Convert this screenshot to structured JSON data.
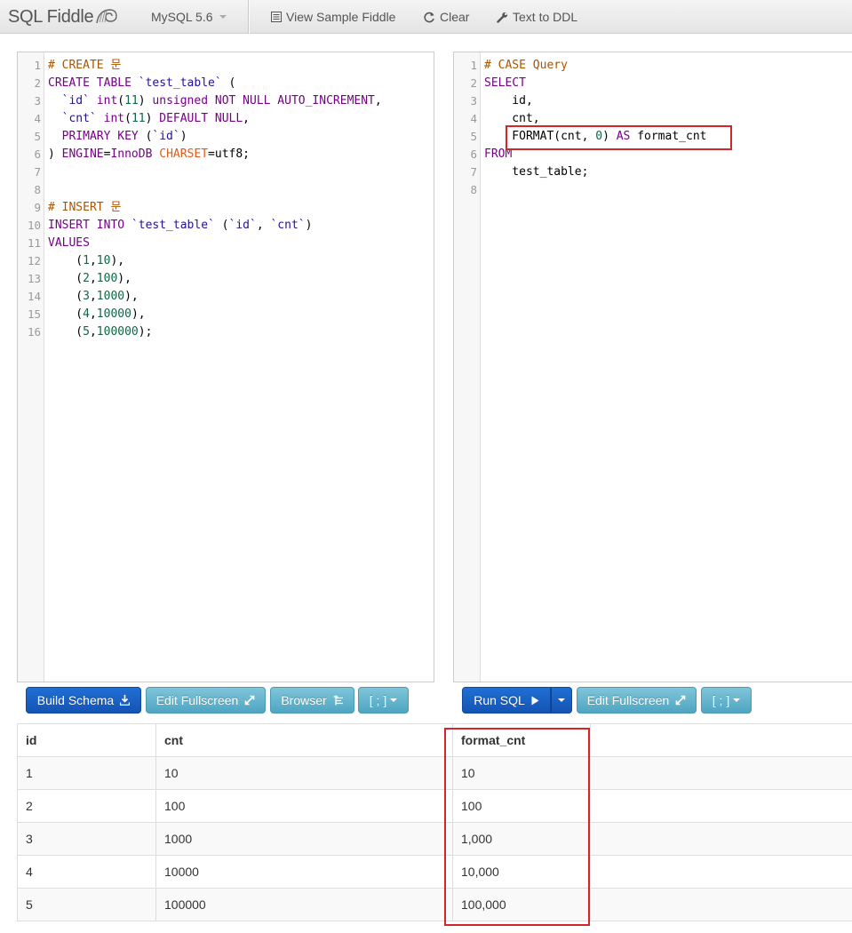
{
  "navbar": {
    "brand": "SQL Fiddle",
    "db_version": "MySQL 5.6",
    "view_sample": "View Sample Fiddle",
    "clear": "Clear",
    "text_to_ddl": "Text to DDL"
  },
  "schema_editor": {
    "lines": [
      {
        "n": "1",
        "t": [
          {
            "c": "c",
            "v": "# CREATE 문"
          }
        ]
      },
      {
        "n": "2",
        "t": [
          {
            "c": "k",
            "v": "CREATE TABLE "
          },
          {
            "c": "s",
            "v": "`test_table`"
          },
          {
            "c": "",
            "v": " ("
          }
        ]
      },
      {
        "n": "3",
        "t": [
          {
            "c": "",
            "v": "  "
          },
          {
            "c": "s",
            "v": "`id`"
          },
          {
            "c": "",
            "v": " "
          },
          {
            "c": "k",
            "v": "int"
          },
          {
            "c": "",
            "v": "("
          },
          {
            "c": "n",
            "v": "11"
          },
          {
            "c": "",
            "v": ") "
          },
          {
            "c": "k",
            "v": "unsigned NOT NULL AUTO_INCREMENT"
          },
          {
            "c": "",
            "v": ","
          }
        ]
      },
      {
        "n": "4",
        "t": [
          {
            "c": "",
            "v": "  "
          },
          {
            "c": "s",
            "v": "`cnt`"
          },
          {
            "c": "",
            "v": " "
          },
          {
            "c": "k",
            "v": "int"
          },
          {
            "c": "",
            "v": "("
          },
          {
            "c": "n",
            "v": "11"
          },
          {
            "c": "",
            "v": ") "
          },
          {
            "c": "k",
            "v": "DEFAULT NULL"
          },
          {
            "c": "",
            "v": ","
          }
        ]
      },
      {
        "n": "5",
        "t": [
          {
            "c": "",
            "v": "  "
          },
          {
            "c": "k",
            "v": "PRIMARY KEY"
          },
          {
            "c": "",
            "v": " ("
          },
          {
            "c": "s",
            "v": "`id`"
          },
          {
            "c": "",
            "v": ")"
          }
        ]
      },
      {
        "n": "6",
        "t": [
          {
            "c": "",
            "v": ") "
          },
          {
            "c": "k",
            "v": "ENGINE"
          },
          {
            "c": "",
            "v": "="
          },
          {
            "c": "k",
            "v": "InnoDB"
          },
          {
            "c": "",
            "v": " "
          },
          {
            "c": "v",
            "v": "CHARSET"
          },
          {
            "c": "",
            "v": "=utf8;"
          }
        ]
      },
      {
        "n": "7",
        "t": []
      },
      {
        "n": "8",
        "t": []
      },
      {
        "n": "9",
        "t": [
          {
            "c": "c",
            "v": "# INSERT 문"
          }
        ]
      },
      {
        "n": "10",
        "t": [
          {
            "c": "k",
            "v": "INSERT INTO "
          },
          {
            "c": "s",
            "v": "`test_table`"
          },
          {
            "c": "",
            "v": " ("
          },
          {
            "c": "s",
            "v": "`id`"
          },
          {
            "c": "",
            "v": ", "
          },
          {
            "c": "s",
            "v": "`cnt`"
          },
          {
            "c": "",
            "v": ")"
          }
        ]
      },
      {
        "n": "11",
        "t": [
          {
            "c": "k",
            "v": "VALUES"
          }
        ]
      },
      {
        "n": "12",
        "t": [
          {
            "c": "",
            "v": "    ("
          },
          {
            "c": "n",
            "v": "1"
          },
          {
            "c": "",
            "v": ","
          },
          {
            "c": "n",
            "v": "10"
          },
          {
            "c": "",
            "v": "),"
          }
        ]
      },
      {
        "n": "13",
        "t": [
          {
            "c": "",
            "v": "    ("
          },
          {
            "c": "n",
            "v": "2"
          },
          {
            "c": "",
            "v": ","
          },
          {
            "c": "n",
            "v": "100"
          },
          {
            "c": "",
            "v": "),"
          }
        ]
      },
      {
        "n": "14",
        "t": [
          {
            "c": "",
            "v": "    ("
          },
          {
            "c": "n",
            "v": "3"
          },
          {
            "c": "",
            "v": ","
          },
          {
            "c": "n",
            "v": "1000"
          },
          {
            "c": "",
            "v": "),"
          }
        ]
      },
      {
        "n": "15",
        "t": [
          {
            "c": "",
            "v": "    ("
          },
          {
            "c": "n",
            "v": "4"
          },
          {
            "c": "",
            "v": ","
          },
          {
            "c": "n",
            "v": "10000"
          },
          {
            "c": "",
            "v": "),"
          }
        ]
      },
      {
        "n": "16",
        "t": [
          {
            "c": "",
            "v": "    ("
          },
          {
            "c": "n",
            "v": "5"
          },
          {
            "c": "",
            "v": ","
          },
          {
            "c": "n",
            "v": "100000"
          },
          {
            "c": "",
            "v": ");"
          }
        ]
      }
    ]
  },
  "query_editor": {
    "lines": [
      {
        "n": "1",
        "t": [
          {
            "c": "c",
            "v": "# CASE Query"
          }
        ]
      },
      {
        "n": "2",
        "t": [
          {
            "c": "k",
            "v": "SELECT"
          }
        ]
      },
      {
        "n": "3",
        "t": [
          {
            "c": "",
            "v": "    id,"
          }
        ]
      },
      {
        "n": "4",
        "t": [
          {
            "c": "",
            "v": "    cnt,"
          }
        ]
      },
      {
        "n": "5",
        "t": [
          {
            "c": "",
            "v": "    FORMAT(cnt, "
          },
          {
            "c": "n",
            "v": "0"
          },
          {
            "c": "",
            "v": ") "
          },
          {
            "c": "k",
            "v": "AS"
          },
          {
            "c": "",
            "v": " format_cnt"
          }
        ]
      },
      {
        "n": "6",
        "t": [
          {
            "c": "k",
            "v": "FROM"
          }
        ]
      },
      {
        "n": "7",
        "t": [
          {
            "c": "",
            "v": "    test_table;"
          }
        ]
      },
      {
        "n": "8",
        "t": []
      }
    ]
  },
  "buttons": {
    "build_schema": "Build Schema",
    "edit_fullscreen": "Edit Fullscreen",
    "browser": "Browser",
    "terminator": "[ ; ]",
    "run_sql": "Run SQL"
  },
  "results": {
    "columns": [
      "id",
      "cnt",
      "format_cnt"
    ],
    "rows": [
      [
        "1",
        "10",
        "10"
      ],
      [
        "2",
        "100",
        "100"
      ],
      [
        "3",
        "1000",
        "1,000"
      ],
      [
        "4",
        "10000",
        "10,000"
      ],
      [
        "5",
        "100000",
        "100,000"
      ]
    ]
  },
  "colors": {
    "primary": "#1a63c8",
    "info": "#5bb0c8",
    "highlight": "#d4252a"
  }
}
